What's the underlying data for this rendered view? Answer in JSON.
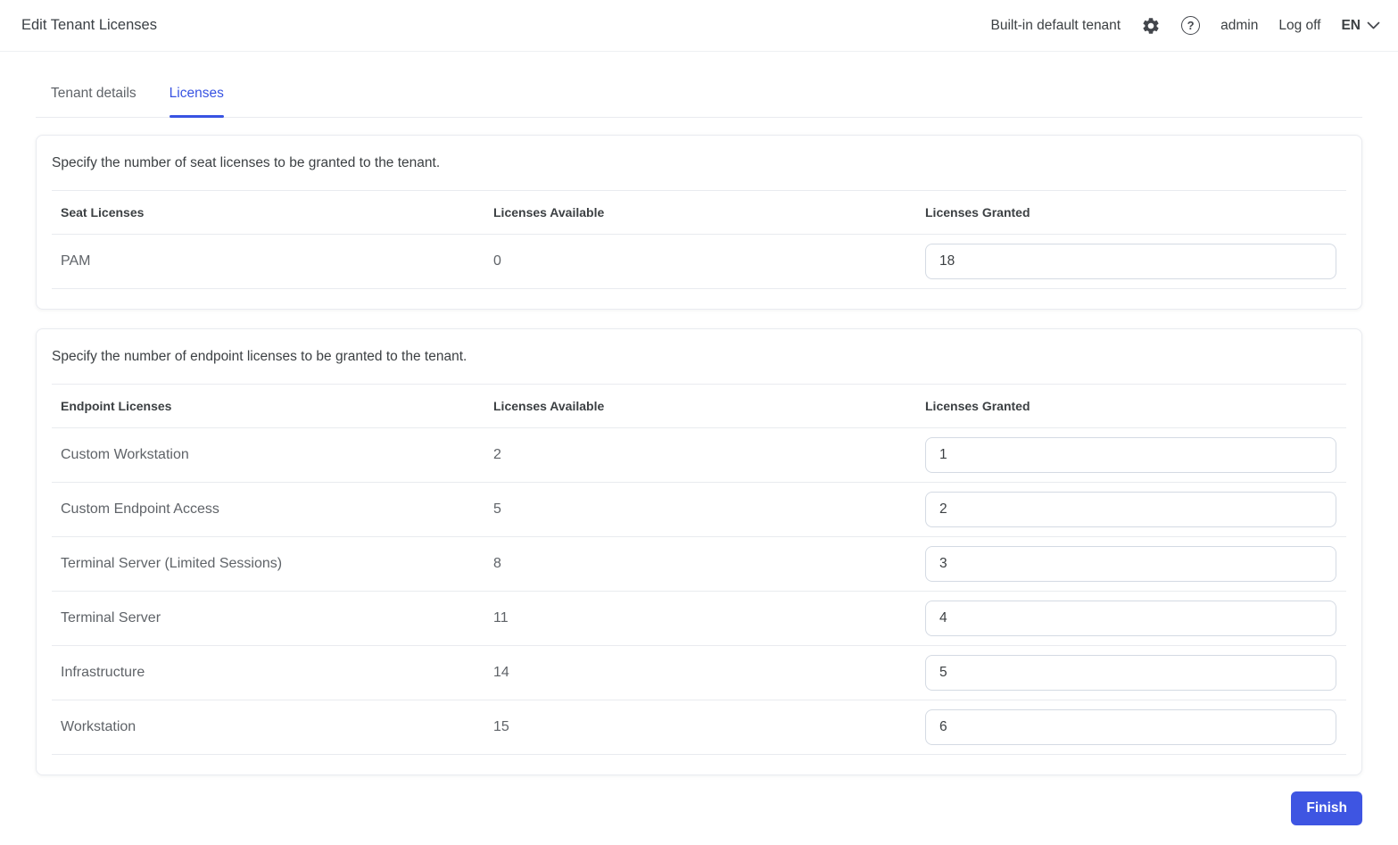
{
  "header": {
    "title": "Edit Tenant Licenses",
    "tenant_label": "Built-in default tenant",
    "help_glyph": "?",
    "user": "admin",
    "logoff_label": "Log off",
    "language": "EN",
    "icons": [
      "gear-icon",
      "help-icon",
      "chevron-down-icon"
    ]
  },
  "tabs": [
    {
      "label": "Tenant details",
      "active": false
    },
    {
      "label": "Licenses",
      "active": true
    }
  ],
  "seat_card": {
    "description": "Specify the number of seat licenses to be granted to the tenant.",
    "columns": [
      "Seat Licenses",
      "Licenses Available",
      "Licenses Granted"
    ],
    "rows": [
      {
        "name": "PAM",
        "available": "0",
        "granted": "18"
      }
    ]
  },
  "endpoint_card": {
    "description": "Specify the number of endpoint licenses to be granted to the tenant.",
    "columns": [
      "Endpoint Licenses",
      "Licenses Available",
      "Licenses Granted"
    ],
    "rows": [
      {
        "name": "Custom Workstation",
        "available": "2",
        "granted": "1"
      },
      {
        "name": "Custom Endpoint Access",
        "available": "5",
        "granted": "2"
      },
      {
        "name": "Terminal Server (Limited Sessions)",
        "available": "8",
        "granted": "3"
      },
      {
        "name": "Terminal Server",
        "available": "11",
        "granted": "4"
      },
      {
        "name": "Infrastructure",
        "available": "14",
        "granted": "5"
      },
      {
        "name": "Workstation",
        "available": "15",
        "granted": "6"
      }
    ]
  },
  "footer": {
    "finish_label": "Finish"
  },
  "colors": {
    "accent": "#3e55e2",
    "text_primary": "#3c4043",
    "text_secondary": "#5f6368",
    "divider": "#e9ebef",
    "input_border": "#d4dae3"
  }
}
